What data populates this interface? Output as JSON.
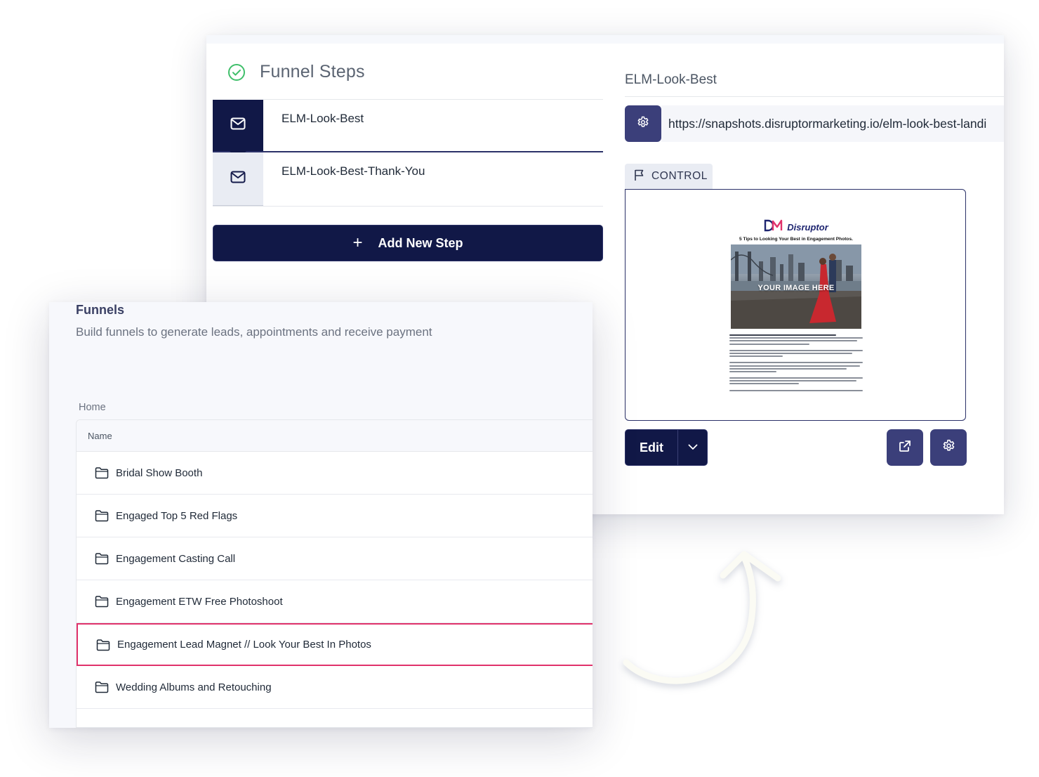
{
  "funnel_steps": {
    "title": "Funnel Steps",
    "steps": [
      {
        "label": "ELM-Look-Best"
      },
      {
        "label": "ELM-Look-Best-Thank-You"
      }
    ],
    "add_step_label": "Add New Step"
  },
  "page_detail": {
    "name": "ELM-Look-Best",
    "url": "https://snapshots.disruptormarketing.io/elm-look-best-landi",
    "variant_tab": "CONTROL",
    "edit_label": "Edit"
  },
  "preview_thumb": {
    "logo_text": "Disruptor",
    "headline": "5 Tips to Looking Your Best in Engagement Photos.",
    "photo_overlay": "YOUR IMAGE HERE"
  },
  "funnels_panel": {
    "title": "Funnels",
    "subtitle": "Build funnels to generate leads, appointments and receive payment",
    "breadcrumb": "Home",
    "column_name": "Name",
    "rows": [
      {
        "name": "Bridal Show Booth"
      },
      {
        "name": "Engaged Top 5 Red Flags"
      },
      {
        "name": "Engagement Casting Call"
      },
      {
        "name": "Engagement ETW Free Photoshoot"
      },
      {
        "name": "Engagement Lead Magnet // Look Your Best In Photos"
      },
      {
        "name": "Wedding Albums and Retouching"
      }
    ],
    "selected_row_index": 4
  },
  "colors": {
    "navy": "#111847",
    "indigo_button": "#3b3f7a",
    "selected_border": "#e0326b",
    "check_green": "#3fbf6a"
  }
}
